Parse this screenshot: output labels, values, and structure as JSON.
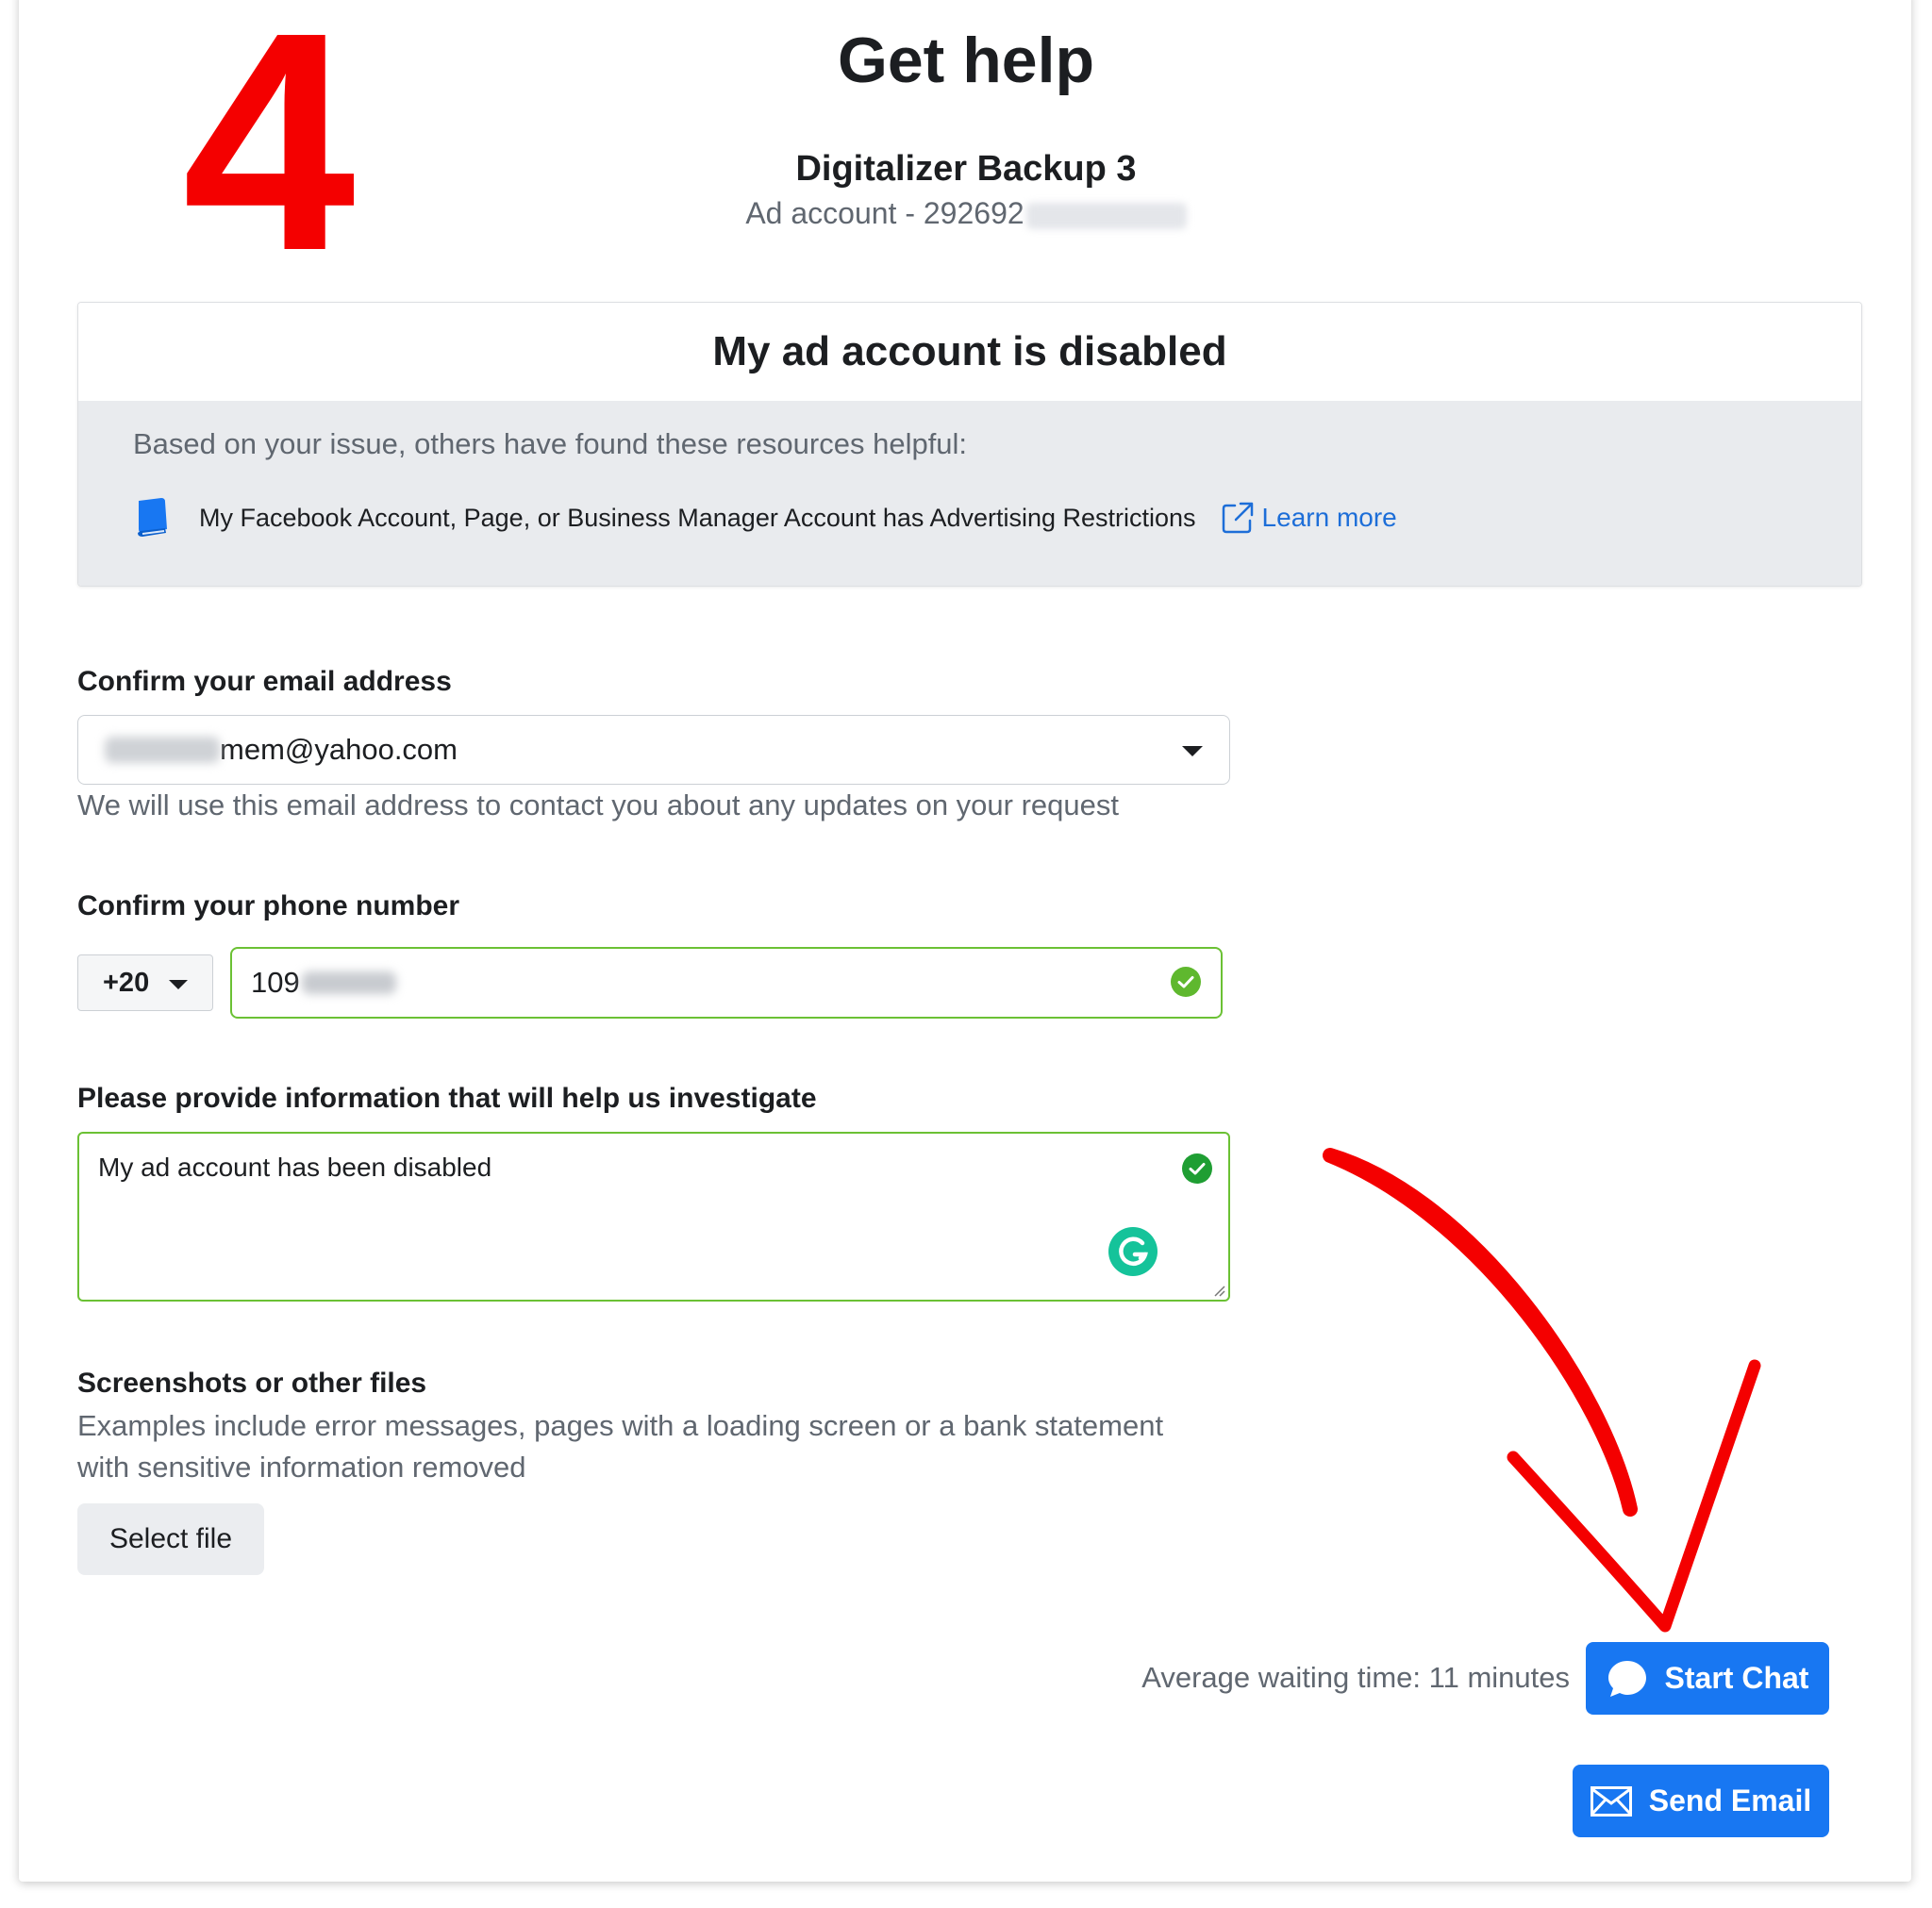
{
  "annotation": {
    "step_number": "4",
    "color": "#f40000"
  },
  "header": {
    "title": "Get help",
    "account_name": "Digitalizer Backup 3",
    "account_id_visible": "Ad account - 292692"
  },
  "issue": {
    "title": "My ad account is disabled",
    "resources_intro": "Based on your issue, others have found these resources helpful:",
    "resource_text": "My Facebook Account, Page, or Business Manager Account has Advertising Restrictions",
    "learn_more": "Learn more",
    "icons": [
      "book-icon",
      "external-link-icon"
    ]
  },
  "email": {
    "label": "Confirm your email address",
    "value_visible": "mem@yahoo.com",
    "help_text": "We will use this email address to contact you about any updates on your request"
  },
  "phone": {
    "label": "Confirm your phone number",
    "country_code": "+20",
    "value_visible": "109"
  },
  "details": {
    "label": "Please provide information that will help us investigate",
    "value": "My ad account has been disabled"
  },
  "files": {
    "label": "Screenshots or other files",
    "description": "Examples include error messages, pages with a loading screen or a bank statement with sensitive information removed",
    "select_label": "Select file"
  },
  "actions": {
    "wait_text": "Average waiting time: 11 minutes",
    "chat_label": "Start Chat",
    "email_label": "Send Email"
  },
  "colors": {
    "primary": "#1877f2",
    "success": "#6bc134",
    "link": "#1d6ed8",
    "panel": "#e9ebee",
    "annotation_red": "#f40000"
  }
}
